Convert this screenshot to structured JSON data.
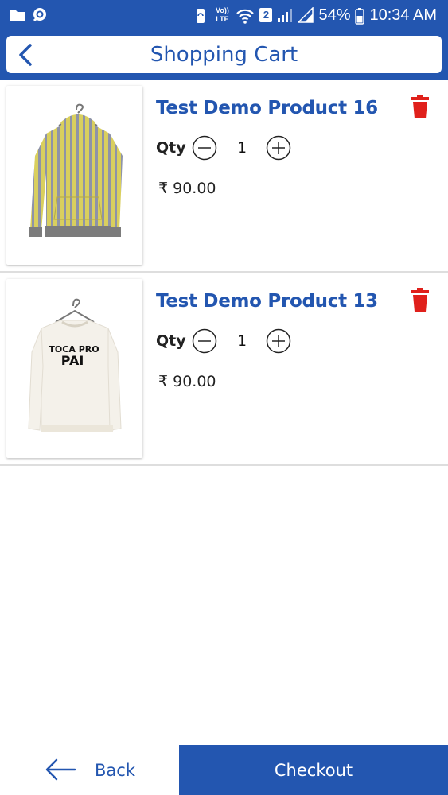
{
  "status_bar": {
    "network_label_top": "Vo))",
    "network_label_bottom": "LTE",
    "sim_badge": "2",
    "battery_percent": "54%",
    "time": "10:34 AM"
  },
  "header": {
    "title": "Shopping Cart"
  },
  "cart": {
    "qty_label": "Qty",
    "items": [
      {
        "name": "Test Demo Product 16",
        "qty": "1",
        "price": "₹ 90.00",
        "image": "striped-hoodie"
      },
      {
        "name": "Test Demo Product 13",
        "qty": "1",
        "price": "₹ 90.00",
        "image": "white-sweatshirt",
        "image_text_line1": "TOCA PRO",
        "image_text_line2": "PAI"
      }
    ]
  },
  "footer": {
    "back_label": "Back",
    "checkout_label": "Checkout"
  },
  "colors": {
    "primary": "#2356b0",
    "delete": "#e0201b"
  }
}
